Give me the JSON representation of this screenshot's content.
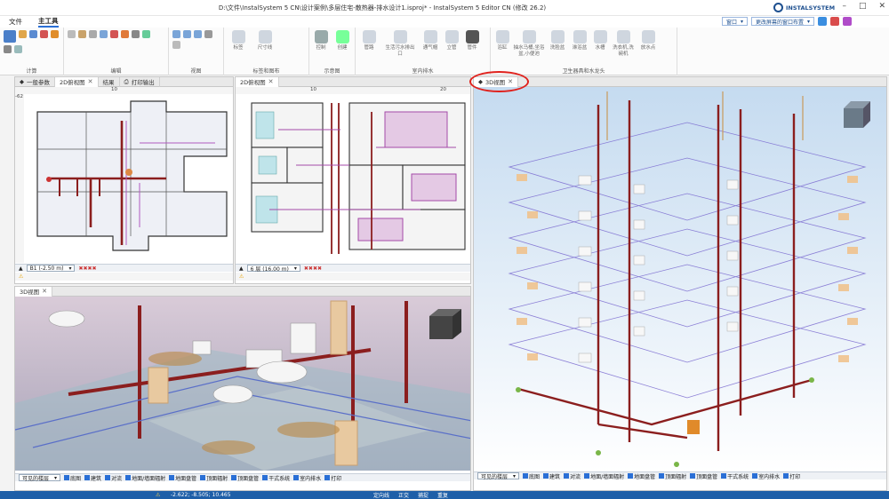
{
  "window": {
    "title": "D:\\文件\\InstalSystem 5 CN\\设计案例\\多层住宅-散热器-排水设计1.isproj* - InstalSystem 5 Editor CN (修改 26.2)",
    "logo": "INSTALSYSTEM"
  },
  "menu": {
    "items": [
      "文件",
      "主工具"
    ],
    "active": "主工具"
  },
  "window_controls": {
    "window_label": "窗口",
    "layout_label": "更改屏幕的窗口布置"
  },
  "ribbon": {
    "groups": [
      {
        "label": "计算"
      },
      {
        "label": "编辑"
      },
      {
        "label": "视图"
      },
      {
        "label": "标签和图布",
        "buttons": [
          "标签",
          "尺寸线"
        ]
      },
      {
        "label": "示意图",
        "buttons": [
          "控制",
          "创建"
        ]
      },
      {
        "label": "室内排水",
        "buttons": [
          "管路",
          "生活污水排出口",
          "通气帽",
          "立管",
          "管件"
        ]
      },
      {
        "label": "卫生器具和水龙头",
        "buttons": [
          "浴缸",
          "抽水马桶,坐浴盆,小便池",
          "洗脸盆",
          "淋浴盆",
          "水槽",
          "洗衣机,洗碗机",
          "放水点"
        ]
      }
    ]
  },
  "panes": {
    "top_left": {
      "tabs": [
        "一般参数",
        "2D俯视图",
        "结果",
        "打印输出"
      ],
      "floor": "B1 (-2.50 m)",
      "ruler_top": "10",
      "ruler_left_mark": "-62"
    },
    "top_mid": {
      "tabs": [
        "2D俯视图"
      ],
      "floor": "6 层 (16.00 m)",
      "ruler_top": [
        "10",
        "20"
      ]
    },
    "bottom_left": {
      "tabs": [
        "3D视图"
      ],
      "visible_layers": "可见的楼层"
    },
    "right": {
      "tabs": [
        "3D视图"
      ],
      "visible_layers": "可见的楼层"
    }
  },
  "layer_toggles": [
    "底图",
    "建筑",
    "对流",
    "地面/墙面辐射",
    "地面盘管",
    "顶面辐射",
    "顶面盘管",
    "干式系统",
    "室内排水",
    "打印"
  ],
  "status": {
    "coords": "-2.622; -8.505; 10.465",
    "items": [
      "定向线",
      "正交",
      "捕捉",
      "重复"
    ]
  },
  "annotation_color": "#e0211c"
}
